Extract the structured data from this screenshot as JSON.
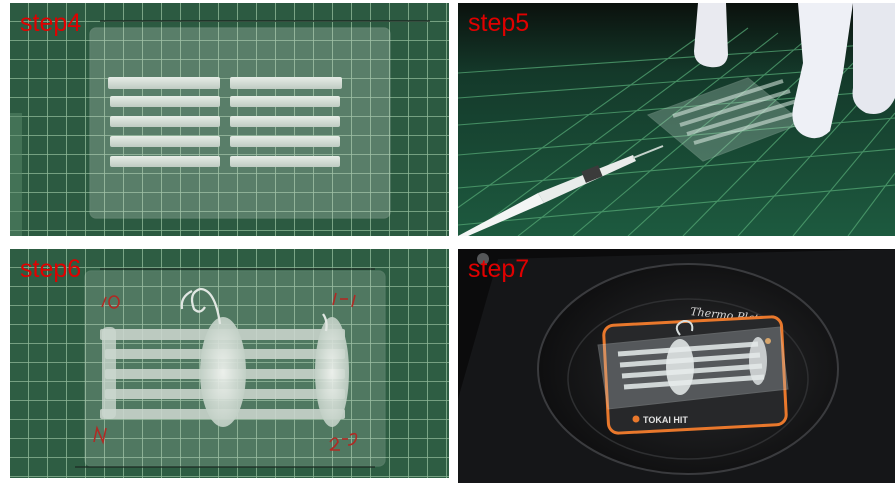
{
  "panels": [
    {
      "label": "step4"
    },
    {
      "label": "step5"
    },
    {
      "label": "step6",
      "marks": {
        "top_left": "10",
        "top_right": "1-1",
        "bottom_left": "N",
        "bottom_right": "2-3"
      }
    },
    {
      "label": "step7",
      "device_text": "Thermo Plate",
      "brand_text": "TOKAI HIT"
    }
  ],
  "colors": {
    "label_red": "#e00000",
    "mat_green": "#2f5f45",
    "grid_line": "#8fb79a",
    "heater_orange": "#e9782c"
  }
}
